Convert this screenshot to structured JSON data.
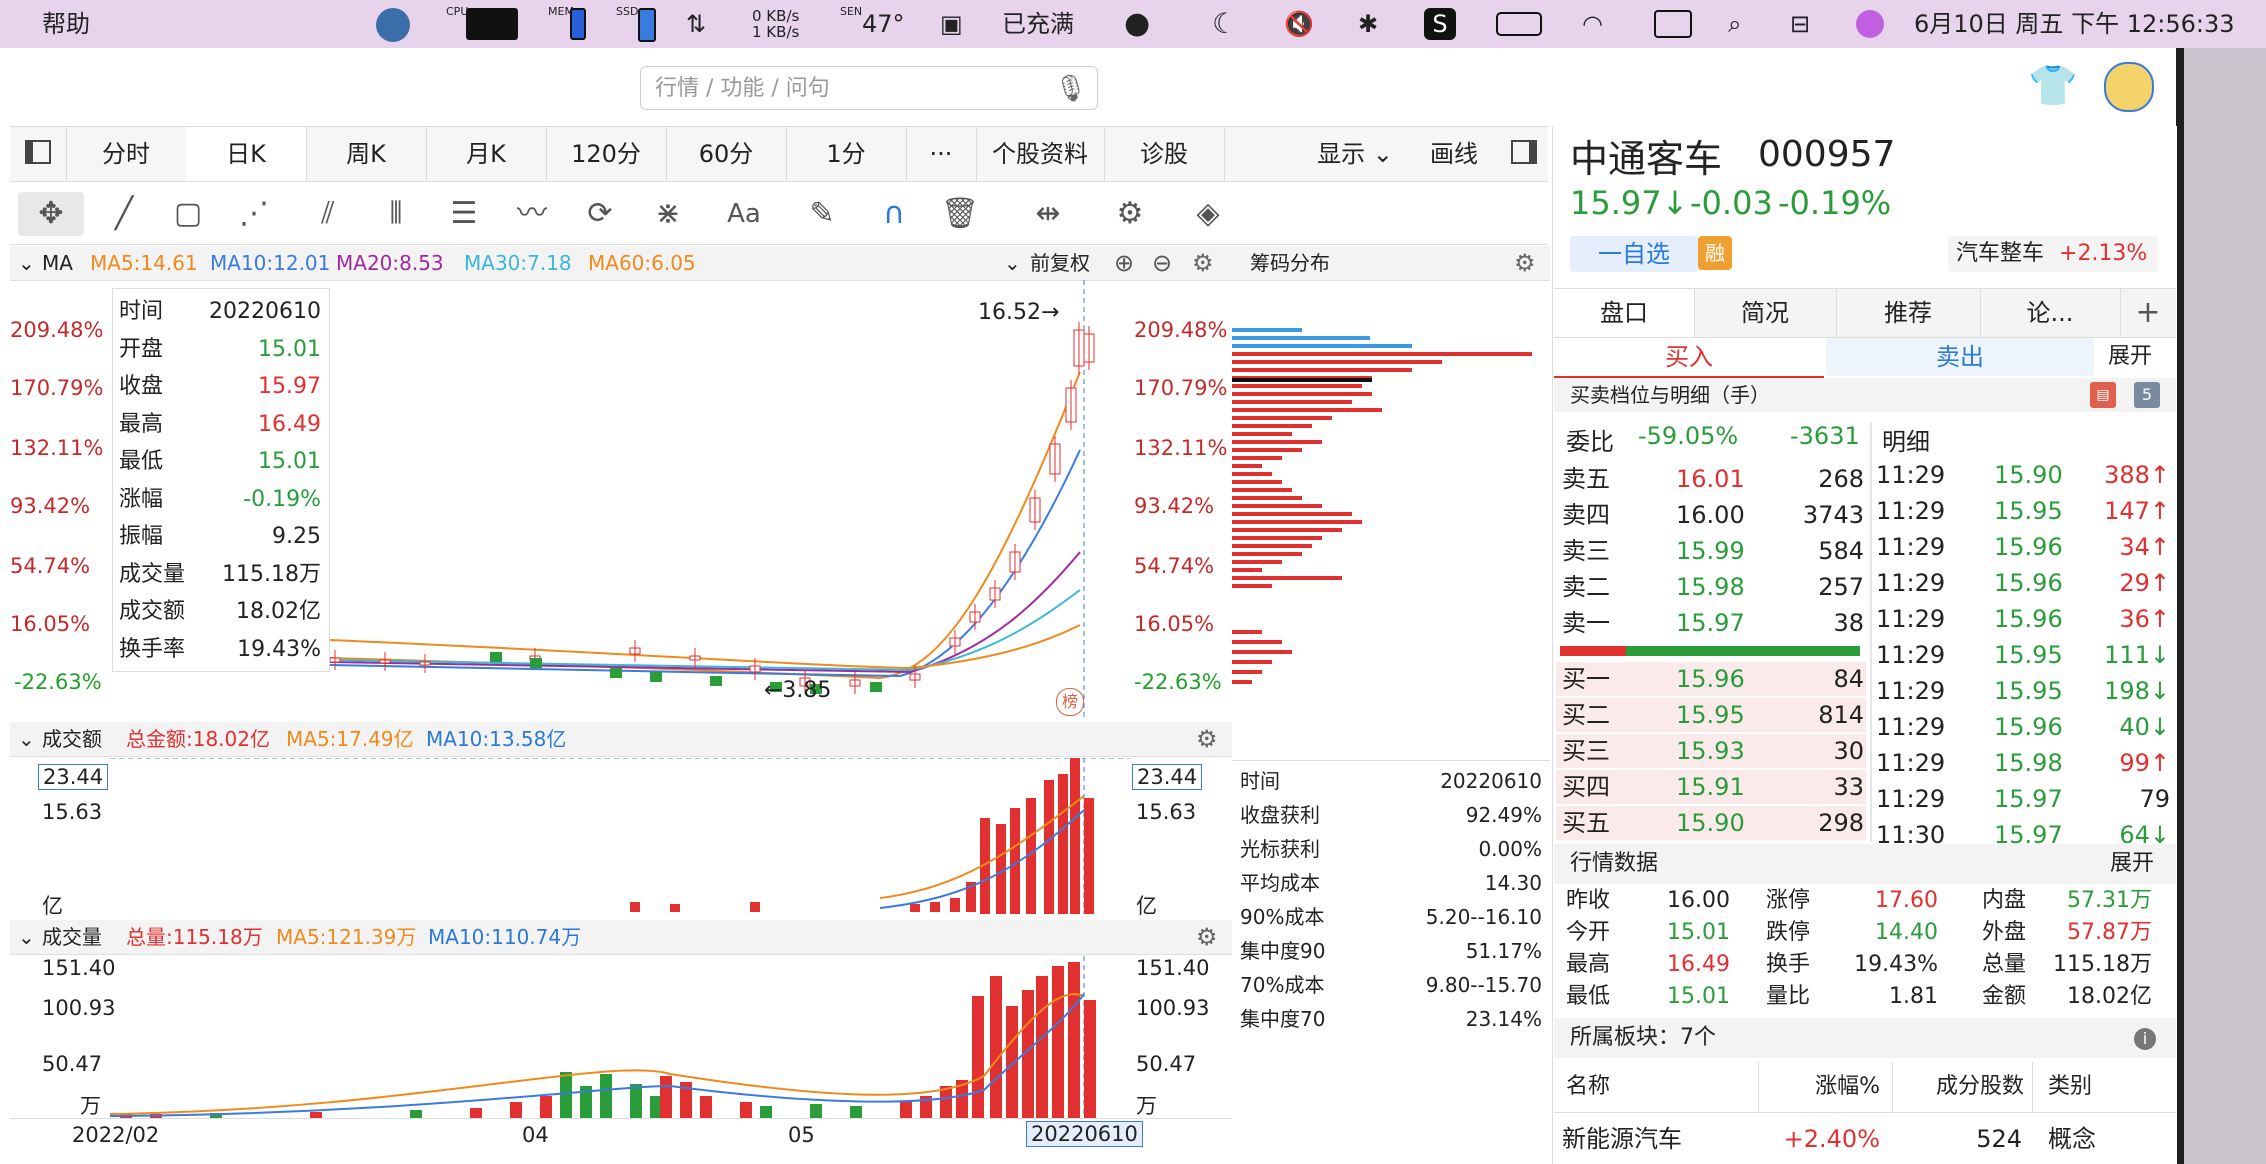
{
  "menubar": {
    "app_menu": "帮助",
    "cpu_label": "CPU",
    "mem_label": "MEM",
    "ssd_label": "SSD",
    "net_up": "0 KB/s",
    "net_down": "1 KB/s",
    "sensor_label": "SEN",
    "temperature": "47°",
    "battery_text": "已充满",
    "datetime": "6月10日 周五 下午 12:56:33"
  },
  "search": {
    "placeholder": "行情 / 功能 / 问句"
  },
  "tabs": [
    "分时",
    "日K",
    "周K",
    "月K",
    "120分",
    "60分",
    "1分",
    "···",
    "个股资料",
    "诊股"
  ],
  "tabs_right": {
    "display": "显示",
    "draw": "画线"
  },
  "ma_legend": {
    "label": "MA",
    "ma5": "MA5:14.61",
    "ma10": "MA10:12.01",
    "ma20": "MA20:8.53",
    "ma30": "MA30:7.18",
    "ma60": "MA60:6.05",
    "adjust": "前复权"
  },
  "colors": {
    "red": "#e03030",
    "green": "#2a9d3a",
    "ma5": "#f08a1c",
    "ma10": "#3a7be0",
    "ma20": "#a02aa0",
    "ma30": "#3ab8d8",
    "ma60": "#f08a1c"
  },
  "price_axis_left": [
    "209.48%",
    "170.79%",
    "132.11%",
    "93.42%",
    "54.74%",
    "16.05%",
    "-22.63%"
  ],
  "price_axis_right": [
    "209.48%",
    "170.79%",
    "132.11%",
    "93.42%",
    "54.74%",
    "16.05%",
    "-22.63%"
  ],
  "hover_info": [
    {
      "k": "时间",
      "v": "20220610"
    },
    {
      "k": "开盘",
      "v": "15.01"
    },
    {
      "k": "收盘",
      "v": "15.97"
    },
    {
      "k": "最高",
      "v": "16.49"
    },
    {
      "k": "最低",
      "v": "15.01"
    },
    {
      "k": "涨幅",
      "v": "-0.19%"
    },
    {
      "k": "振幅",
      "v": "9.25"
    },
    {
      "k": "成交量",
      "v": "115.18万"
    },
    {
      "k": "成交额",
      "v": "18.02亿"
    },
    {
      "k": "换手率",
      "v": "19.43%"
    }
  ],
  "high_marker": "16.52→",
  "low_marker": "←3.85",
  "rank_badge": "榜",
  "chip_title": "筹码分布",
  "chip_stats": [
    {
      "k": "时间",
      "v": "20220610"
    },
    {
      "k": "收盘获利",
      "v": "92.49%"
    },
    {
      "k": "光标获利",
      "v": "0.00%"
    },
    {
      "k": "平均成本",
      "v": "14.30"
    },
    {
      "k": "90%成本",
      "v": "5.20--16.10"
    },
    {
      "k": "集中度90",
      "v": "51.17%"
    },
    {
      "k": "70%成本",
      "v": "9.80--15.70"
    },
    {
      "k": "集中度70",
      "v": "23.14%"
    }
  ],
  "amount_panel": {
    "title": "成交额",
    "total": "总金额:18.02亿",
    "ma5": "MA5:17.49亿",
    "ma10": "MA10:13.58亿",
    "axis": [
      "23.44",
      "15.63",
      "亿"
    ],
    "axis_right": [
      "23.44",
      "15.63",
      "亿"
    ]
  },
  "volume_panel": {
    "title": "成交量",
    "total": "总量:115.18万",
    "ma5": "MA5:121.39万",
    "ma10": "MA10:110.74万",
    "axis": [
      "151.40",
      "100.93",
      "50.47",
      "万"
    ],
    "axis_right": [
      "151.40",
      "100.93",
      "50.47",
      "万"
    ]
  },
  "date_axis": [
    "2022/02",
    "04",
    "05",
    "20220610"
  ],
  "stock": {
    "name": "中通客车",
    "code": "000957",
    "price": "15.97↓",
    "change": "-0.03",
    "change_pct": "-0.19%",
    "watch_btn": "一自选",
    "margin_badge": "融",
    "sector": "汽车整车",
    "sector_change": "+2.13%"
  },
  "rtabs": [
    "盘口",
    "简况",
    "推荐",
    "论..."
  ],
  "buy_sell": {
    "buy": "买入",
    "sell": "卖出",
    "expand": "展开"
  },
  "orderbook_title": "买卖档位与明细（手）",
  "orderbook_badge": "5",
  "weibi": {
    "label": "委比",
    "pct": "-59.05%",
    "val": "-3631"
  },
  "detail_title": "明细",
  "asks": [
    {
      "k": "卖五",
      "p": "16.01",
      "v": "268"
    },
    {
      "k": "卖四",
      "p": "16.00",
      "v": "3743"
    },
    {
      "k": "卖三",
      "p": "15.99",
      "v": "584"
    },
    {
      "k": "卖二",
      "p": "15.98",
      "v": "257"
    },
    {
      "k": "卖一",
      "p": "15.97",
      "v": "38"
    }
  ],
  "bids": [
    {
      "k": "买一",
      "p": "15.96",
      "v": "84"
    },
    {
      "k": "买二",
      "p": "15.95",
      "v": "814"
    },
    {
      "k": "买三",
      "p": "15.93",
      "v": "30"
    },
    {
      "k": "买四",
      "p": "15.91",
      "v": "33"
    },
    {
      "k": "买五",
      "p": "15.90",
      "v": "298"
    }
  ],
  "ticks": [
    {
      "t": "11:29",
      "p": "15.90",
      "v": "388↑"
    },
    {
      "t": "11:29",
      "p": "15.95",
      "v": "147↑"
    },
    {
      "t": "11:29",
      "p": "15.96",
      "v": "34↑"
    },
    {
      "t": "11:29",
      "p": "15.96",
      "v": "29↑"
    },
    {
      "t": "11:29",
      "p": "15.96",
      "v": "36↑"
    },
    {
      "t": "11:29",
      "p": "15.95",
      "v": "111↓"
    },
    {
      "t": "11:29",
      "p": "15.95",
      "v": "198↓"
    },
    {
      "t": "11:29",
      "p": "15.96",
      "v": "40↓"
    },
    {
      "t": "11:29",
      "p": "15.98",
      "v": "99↑"
    },
    {
      "t": "11:29",
      "p": "15.97",
      "v": "79"
    },
    {
      "t": "11:30",
      "p": "15.97",
      "v": "64↓"
    }
  ],
  "quote_title": "行情数据",
  "quote_expand": "展开",
  "quote": [
    [
      "昨收",
      "16.00",
      "涨停",
      "17.60",
      "内盘",
      "57.31万"
    ],
    [
      "今开",
      "15.01",
      "跌停",
      "14.40",
      "外盘",
      "57.87万"
    ],
    [
      "最高",
      "16.49",
      "换手",
      "19.43%",
      "总量",
      "115.18万"
    ],
    [
      "最低",
      "15.01",
      "量比",
      "1.81",
      "金额",
      "18.02亿"
    ]
  ],
  "sector_block": {
    "title": "所属板块：7个",
    "headers": [
      "名称",
      "涨幅%",
      "成分股数",
      "类别"
    ],
    "row": [
      "新能源汽车",
      "+2.40%",
      "524",
      "概念"
    ]
  }
}
